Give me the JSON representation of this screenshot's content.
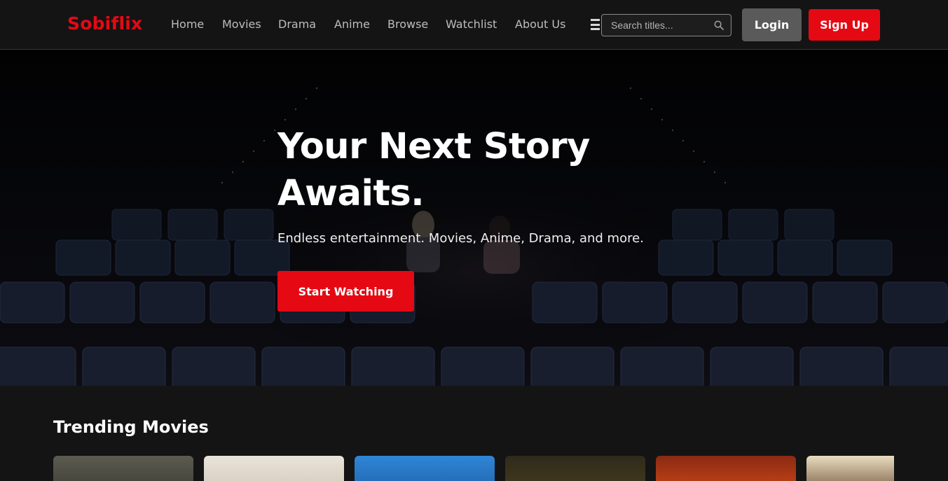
{
  "brand": {
    "name": "Sobiflix",
    "color": "#e50914"
  },
  "nav": {
    "links": [
      "Home",
      "Movies",
      "Drama",
      "Anime",
      "Browse",
      "Watchlist",
      "About Us"
    ],
    "menu_icon": "menu-icon"
  },
  "search": {
    "placeholder": "Search titles...",
    "value": "",
    "icon": "search-icon"
  },
  "auth": {
    "login_label": "Login",
    "signup_label": "Sign Up"
  },
  "hero": {
    "title": "Your Next Story Awaits.",
    "subtitle": "Endless entertainment. Movies, Anime, Drama, and more.",
    "cta_label": "Start Watching"
  },
  "trending": {
    "title": "Trending Movies",
    "posters": [
      {
        "color_top": "#5b5b50",
        "color_bottom": "#3a3a32"
      },
      {
        "color_top": "#e9e4da",
        "color_bottom": "#cfc7b5"
      },
      {
        "color_top": "#2f86d6",
        "color_bottom": "#1f5fa8"
      },
      {
        "color_top": "#2e2a1c",
        "color_bottom": "#4a3d1e"
      },
      {
        "color_top": "#8a2a14",
        "color_bottom": "#d24a16"
      },
      {
        "color_top": "#e8dcc0",
        "color_bottom": "#6b4a30"
      }
    ]
  },
  "colors": {
    "background": "#141414",
    "accent": "#e50914",
    "login_bg": "#5a5a5a"
  }
}
